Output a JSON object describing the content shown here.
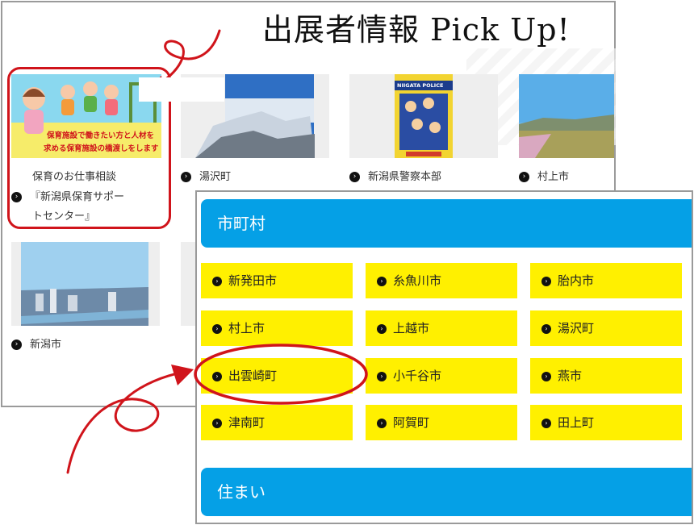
{
  "header": {
    "title": "出展者情報 Pick Up!"
  },
  "exhibitors": [
    {
      "label_line1": "保育のお仕事相談",
      "label_line2": "『新潟県保育サポー",
      "label_line3": "トセンター』",
      "banner_line1": "保育施設で働きたい方と人材を",
      "banner_line2": "求める保育施設の橋渡しをします"
    },
    {
      "label": "湯沢町"
    },
    {
      "label": "新潟県警察本部",
      "poster_text": "NIIGATA POLICE"
    },
    {
      "label": "村上市"
    },
    {
      "label": "新潟市"
    }
  ],
  "municipalities": {
    "header": "市町村",
    "items": [
      "新発田市",
      "糸魚川市",
      "胎内市",
      "村上市",
      "上越市",
      "湯沢町",
      "出雲崎町",
      "小千谷市",
      "燕市",
      "津南町",
      "阿賀町",
      "田上町"
    ]
  },
  "housing": {
    "header": "住まい"
  },
  "icons": {
    "arrow": "circle-chevron-right-icon"
  },
  "colors": {
    "accent_blue": "#05a0e6",
    "button_yellow": "#fff000",
    "annotation_red": "#d0141b"
  }
}
